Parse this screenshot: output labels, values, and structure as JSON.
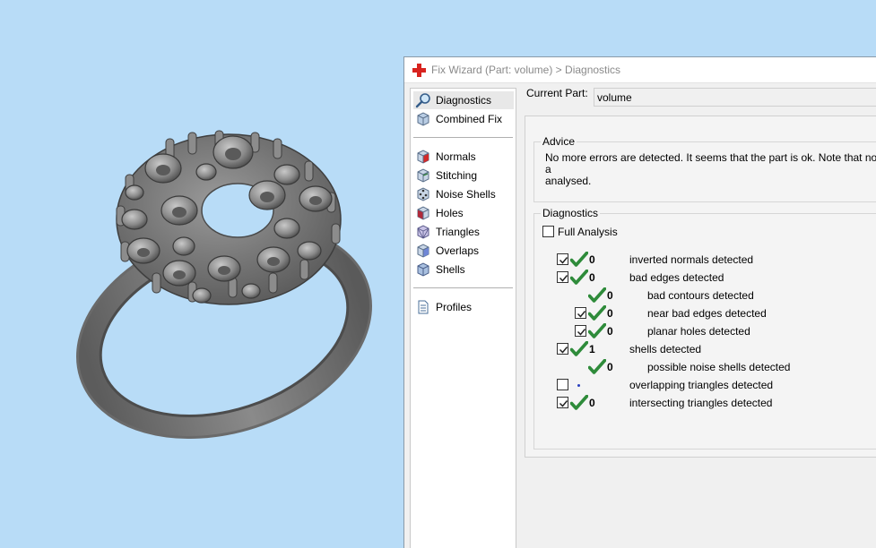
{
  "dialog": {
    "title": "Fix Wizard (Part: volume) > Diagnostics",
    "title_icon": "red-cross-icon"
  },
  "nav": {
    "items": [
      {
        "label": "Diagnostics",
        "icon": "magnifier-icon",
        "selected": true
      },
      {
        "label": "Combined Fix",
        "icon": "cube-icon",
        "selected": false
      },
      {
        "label": "Normals",
        "icon": "normals-cube-icon",
        "selected": false
      },
      {
        "label": "Stitching",
        "icon": "stitching-cube-icon",
        "selected": false
      },
      {
        "label": "Noise Shells",
        "icon": "noise-shells-cube-icon",
        "selected": false
      },
      {
        "label": "Holes",
        "icon": "holes-cube-icon",
        "selected": false
      },
      {
        "label": "Triangles",
        "icon": "triangles-cube-icon",
        "selected": false
      },
      {
        "label": "Overlaps",
        "icon": "overlaps-cube-icon",
        "selected": false
      },
      {
        "label": "Shells",
        "icon": "shells-cube-icon",
        "selected": false
      },
      {
        "label": "Profiles",
        "icon": "document-icon",
        "selected": false
      }
    ]
  },
  "current_part": {
    "label": "Current Part:",
    "value": "volume"
  },
  "advice": {
    "title": "Advice",
    "text": "No more errors are detected. It seems that the part is ok. Note that not a\nanalysed."
  },
  "diagnostics": {
    "title": "Diagnostics",
    "full_analysis_label": "Full Analysis",
    "full_analysis_checked": false,
    "rows": [
      {
        "checkbox": true,
        "checked": true,
        "status": "ok",
        "count": "0",
        "label": "inverted normals detected",
        "indent": 0
      },
      {
        "checkbox": true,
        "checked": true,
        "status": "ok",
        "count": "0",
        "label": "bad edges detected",
        "indent": 0
      },
      {
        "checkbox": false,
        "checked": false,
        "status": "ok",
        "count": "0",
        "label": "bad contours detected",
        "indent": 1
      },
      {
        "checkbox": true,
        "checked": true,
        "status": "ok",
        "count": "0",
        "label": "near bad edges detected",
        "indent": 1
      },
      {
        "checkbox": true,
        "checked": true,
        "status": "ok",
        "count": "0",
        "label": "planar holes detected",
        "indent": 1
      },
      {
        "checkbox": true,
        "checked": true,
        "status": "ok",
        "count": "1",
        "label": "shells detected",
        "indent": 0
      },
      {
        "checkbox": false,
        "checked": false,
        "status": "ok",
        "count": "0",
        "label": "possible noise shells detected",
        "indent": 1
      },
      {
        "checkbox": true,
        "checked": false,
        "status": "not-run",
        "count": "",
        "label": "overlapping triangles detected",
        "indent": 0
      },
      {
        "checkbox": true,
        "checked": true,
        "status": "ok",
        "count": "0",
        "label": "intersecting triangles detected",
        "indent": 0
      }
    ]
  },
  "colors": {
    "viewport_bg": "#b8dcf7",
    "check_green": "#2e8b3a",
    "model_gray": "#7a7a7a"
  }
}
